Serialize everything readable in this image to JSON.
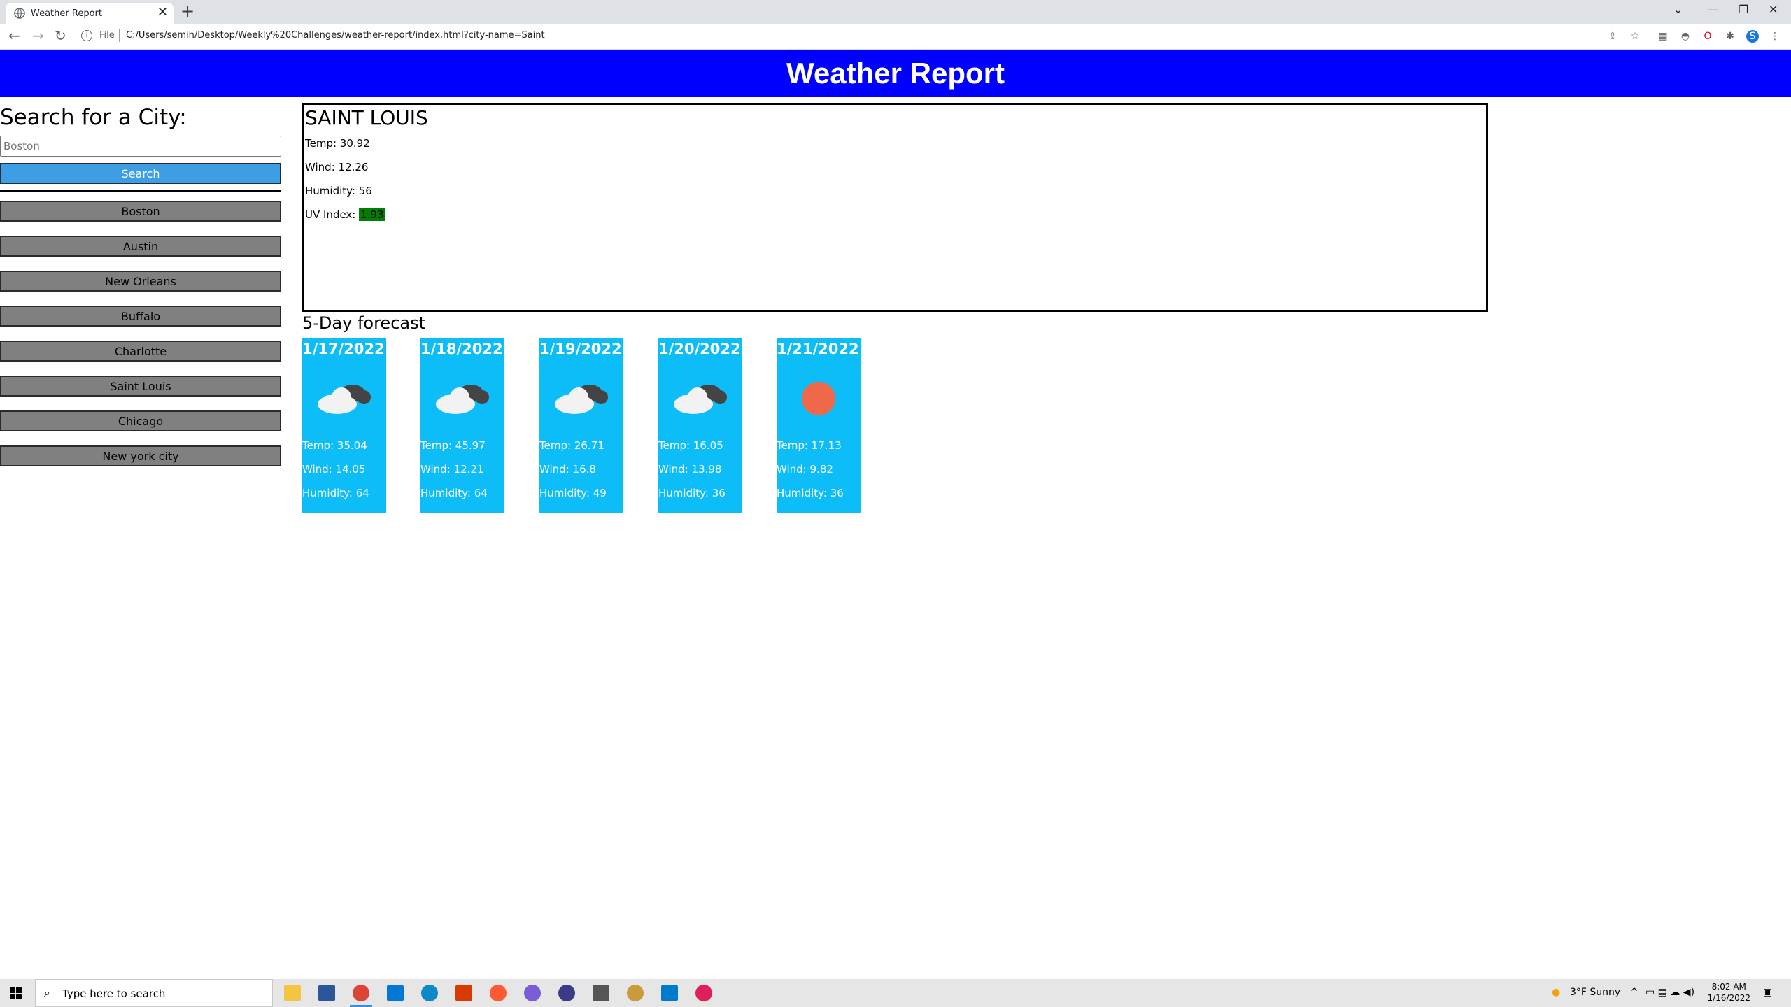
{
  "browser": {
    "tab_title": "Weather Report",
    "tab_close": "✕",
    "new_tab": "+",
    "omnibox_prefix": "File",
    "url": "C:/Users/semih/Desktop/Weekly%20Challenges/weather-report/index.html?city-name=Saint",
    "profile_initial": "S"
  },
  "page": {
    "header_title": "Weather Report",
    "sidebar": {
      "heading": "Search for a City:",
      "search_placeholder": "Boston",
      "search_button": "Search",
      "history": [
        "Boston",
        "Austin",
        "New Orleans",
        "Buffalo",
        "Charlotte",
        "Saint Louis",
        "Chicago",
        "New york city"
      ]
    },
    "current": {
      "city": "SAINT LOUIS",
      "temp": "Temp: 30.92",
      "wind": "Wind: 12.26",
      "humidity": "Humidity: 56",
      "uv_label": "UV Index: ",
      "uv_value": "1.93",
      "uv_color": "#008000"
    },
    "forecast": {
      "title": "5-Day forecast",
      "days": [
        {
          "date": "1/17/2022",
          "icon": "cloud-icon",
          "temp": "Temp: 35.04",
          "wind": "Wind: 14.05",
          "humidity": "Humidity: 64"
        },
        {
          "date": "1/18/2022",
          "icon": "cloud-icon",
          "temp": "Temp: 45.97",
          "wind": "Wind: 12.21",
          "humidity": "Humidity: 64"
        },
        {
          "date": "1/19/2022",
          "icon": "cloud-icon",
          "temp": "Temp: 26.71",
          "wind": "Wind: 16.8",
          "humidity": "Humidity: 49"
        },
        {
          "date": "1/20/2022",
          "icon": "cloud-icon",
          "temp": "Temp: 16.05",
          "wind": "Wind: 13.98",
          "humidity": "Humidity: 36"
        },
        {
          "date": "1/21/2022",
          "icon": "sun-icon",
          "temp": "Temp: 17.13",
          "wind": "Wind: 9.82",
          "humidity": "Humidity: 36"
        }
      ]
    }
  },
  "taskbar": {
    "search_placeholder": "Type here to search",
    "weather": "3°F  Sunny",
    "time": "8:02 AM",
    "date": "1/16/2022"
  },
  "colors": {
    "header_bg": "#0000ff",
    "search_button_bg": "#3d9ee6",
    "history_button_bg": "#808080",
    "forecast_card_bg": "#0dbdf8"
  }
}
